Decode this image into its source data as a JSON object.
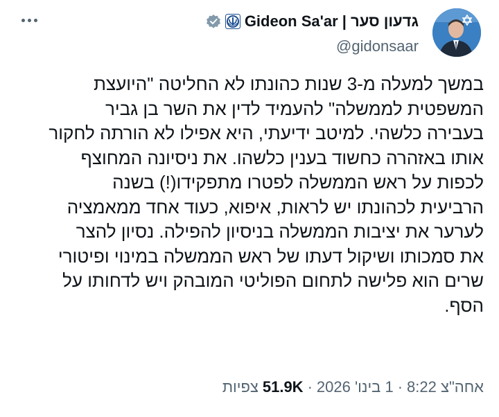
{
  "author": {
    "display_name": "גדעון סער | Gideon Sa'ar",
    "handle": "@gidonsaar",
    "verified": true,
    "badge_icon": "israel-emblem-icon",
    "verified_icon": "verified-check-icon",
    "verified_color": "#829aab"
  },
  "more_menu": {
    "icon": "more-horizontal-icon"
  },
  "tweet": {
    "lines": [
      "במשך למעלה מ-3 שנות כהונתו לא החליטה \"היועצת",
      "המשפטית לממשלה\" להעמיד לדין את השר בן גביר",
      "בעבירה כלשהי. למיטב ידיעתי, היא אפילו לא הורתה לחקור",
      "אותו באזהרה כחשוד בענין כלשהו. את ניסיונה המחוצף",
      "לכפות על ראש הממשלה לפטרו מתפקידו(!) בשנה",
      "הרביעית לכהונתו יש לראות, איפוא, כעוד אחד ממאמציה",
      "לערער את יציבות הממשלה בניסיון להפילה. נסיון להצר",
      "את סמכותו ושיקול דעתו של ראש הממשלה במינוי ופיטורי",
      "שרים הוא פלישה לתחום הפוליטי המובהק ויש לדחותו על",
      "הסף."
    ]
  },
  "meta": {
    "time": "אחה\"צ 8:22",
    "date": "1 בינו' 2026",
    "views_label": "צפיות",
    "views_count": "51.9K",
    "separator": "·"
  }
}
